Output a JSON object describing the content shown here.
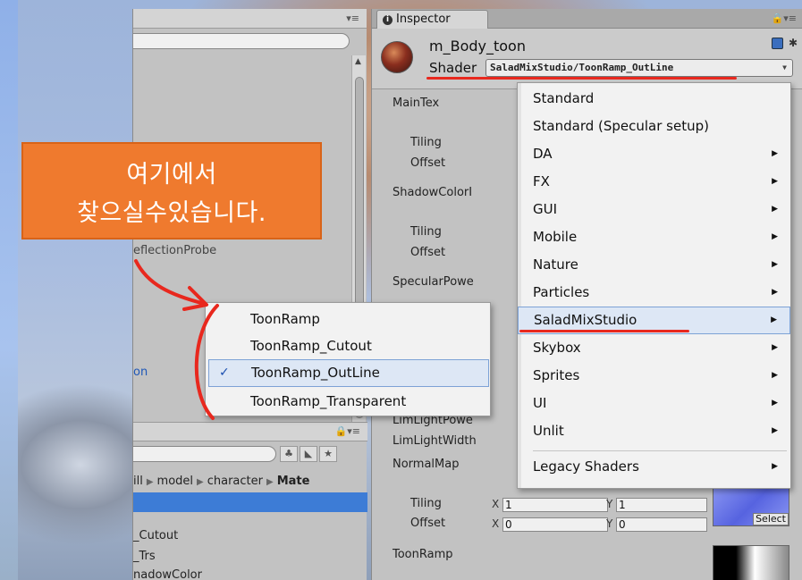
{
  "left_panel": {
    "probe_text": "eflectionProbe",
    "on_text": "on",
    "breadcrumb": [
      "ill",
      "model",
      "character",
      "Mate"
    ],
    "files": [
      "_Cutout",
      "_Trs",
      "nadowColor"
    ]
  },
  "inspector": {
    "tab_title": "Inspector",
    "material_name": "m_Body_toon",
    "shader_label": "Shader",
    "shader_value": "SaladMixStudio/ToonRamp_OutLine",
    "properties": {
      "main_tex": "MainTex",
      "tiling1": "Tiling",
      "offset1": "Offset",
      "shadow_color": "ShadowColorI",
      "tiling2": "Tiling",
      "offset2": "Offset",
      "specular_power": "SpecularPowe",
      "rim_light_power": "LimLightPowe",
      "rim_light_width": "LimLightWidth",
      "normal_map": "NormalMap",
      "tiling3": "Tiling",
      "offset3": "Offset",
      "toon_ramp": "ToonRamp",
      "x_label": "X",
      "y_label": "Y",
      "tiling3_x": "1",
      "tiling3_y": "1",
      "offset3_x": "0",
      "offset3_y": "0",
      "select_label": "Select"
    }
  },
  "shader_menu": {
    "items": [
      {
        "label": "Standard",
        "has_submenu": false
      },
      {
        "label": "Standard (Specular setup)",
        "has_submenu": false
      },
      {
        "label": "DA",
        "has_submenu": true
      },
      {
        "label": "FX",
        "has_submenu": true
      },
      {
        "label": "GUI",
        "has_submenu": true
      },
      {
        "label": "Mobile",
        "has_submenu": true
      },
      {
        "label": "Nature",
        "has_submenu": true
      },
      {
        "label": "Particles",
        "has_submenu": true
      },
      {
        "label": "SaladMixStudio",
        "has_submenu": true,
        "highlighted": true
      },
      {
        "label": "Skybox",
        "has_submenu": true
      },
      {
        "label": "Sprites",
        "has_submenu": true
      },
      {
        "label": "UI",
        "has_submenu": true
      },
      {
        "label": "Unlit",
        "has_submenu": true
      },
      {
        "label": "Legacy Shaders",
        "has_submenu": true
      }
    ]
  },
  "sub_menu": {
    "items": [
      {
        "label": "ToonRamp",
        "checked": false
      },
      {
        "label": "ToonRamp_Cutout",
        "checked": false
      },
      {
        "label": "ToonRamp_OutLine",
        "checked": true
      },
      {
        "label": "ToonRamp_Transparent",
        "checked": false
      }
    ]
  },
  "callout": {
    "line1": "여기에서",
    "line2": "찾으실수있습니다."
  },
  "colors": {
    "accent_orange": "#ef7a2e",
    "annotation_red": "#e8281e",
    "highlight_blue": "#3d7cd6"
  }
}
